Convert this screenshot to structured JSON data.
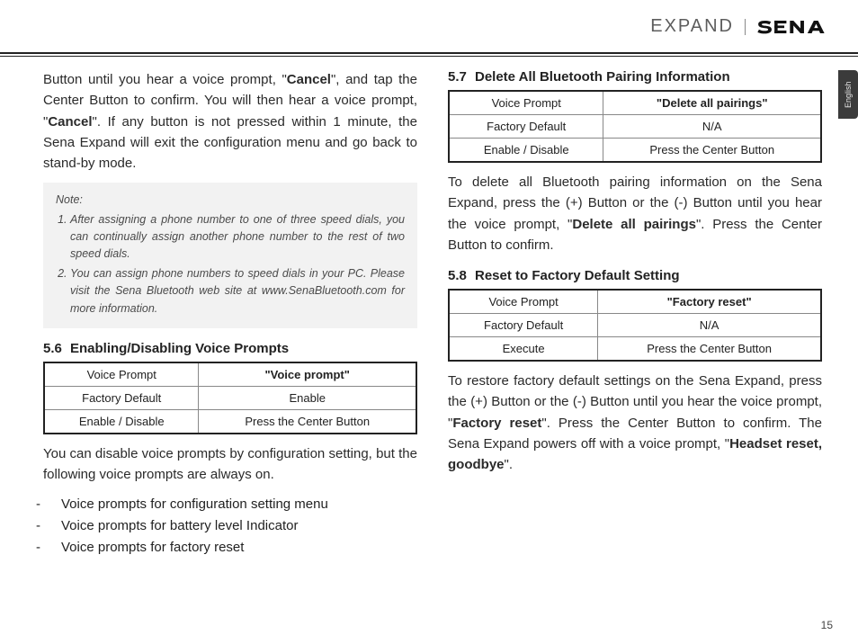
{
  "header": {
    "product": "EXPAND",
    "brand": "SENA"
  },
  "langTab": "English",
  "pageNumber": "15",
  "left": {
    "introPara": [
      "Button until you hear a voice prompt, \"",
      "Cancel",
      "\", and tap the Center Button to confirm. You will then hear a voice prompt, \"",
      "Cancel",
      "\". If any button is not pressed within 1 minute, the Sena Expand will exit the configuration menu and go back to stand-by mode."
    ],
    "note": {
      "label": "Note:",
      "items": [
        "After assigning a phone number to one of three speed dials, you can continually assign another phone number to the rest of two speed dials.",
        "You can assign phone numbers to speed dials in your PC. Please visit the Sena Bluetooth web site at www.SenaBluetooth.com for more information."
      ]
    },
    "sec56": {
      "num": "5.6",
      "title": "Enabling/Disabling Voice Prompts",
      "table": {
        "r1c1": "Voice Prompt",
        "r1c2": "\"Voice prompt\"",
        "r2c1": "Factory Default",
        "r2c2": "Enable",
        "r3c1": "Enable / Disable",
        "r3c2": "Press the Center Button"
      },
      "para": "You can disable voice prompts by configuration setting, but the following voice prompts are always on.",
      "bullets": [
        "Voice prompts for configuration setting menu",
        "Voice prompts for battery level Indicator",
        "Voice prompts for factory reset"
      ]
    }
  },
  "right": {
    "sec57": {
      "num": "5.7",
      "title": "Delete All Bluetooth Pairing Information",
      "table": {
        "r1c1": "Voice Prompt",
        "r1c2": "\"Delete all pairings\"",
        "r2c1": "Factory Default",
        "r2c2": "N/A",
        "r3c1": "Enable / Disable",
        "r3c2": "Press the Center Button"
      },
      "para": [
        "To delete all Bluetooth pairing information on the Sena Expand, press the (+) Button or the (-) Button until you hear the voice prompt, \"",
        "Delete all pairings",
        "\". Press the Center Button to confirm."
      ]
    },
    "sec58": {
      "num": "5.8",
      "title": "Reset to Factory Default Setting",
      "table": {
        "r1c1": "Voice Prompt",
        "r1c2": "\"Factory reset\"",
        "r2c1": "Factory Default",
        "r2c2": "N/A",
        "r3c1": "Execute",
        "r3c2": "Press the Center Button"
      },
      "para": [
        "To restore factory default settings on the Sena Expand, press the (+) Button or the (-) Button until you hear the voice prompt, \"",
        "Factory reset",
        "\". Press the Center Button to confirm. The Sena Expand powers off with a voice prompt, \"",
        "Headset reset, goodbye",
        "\"."
      ]
    }
  }
}
